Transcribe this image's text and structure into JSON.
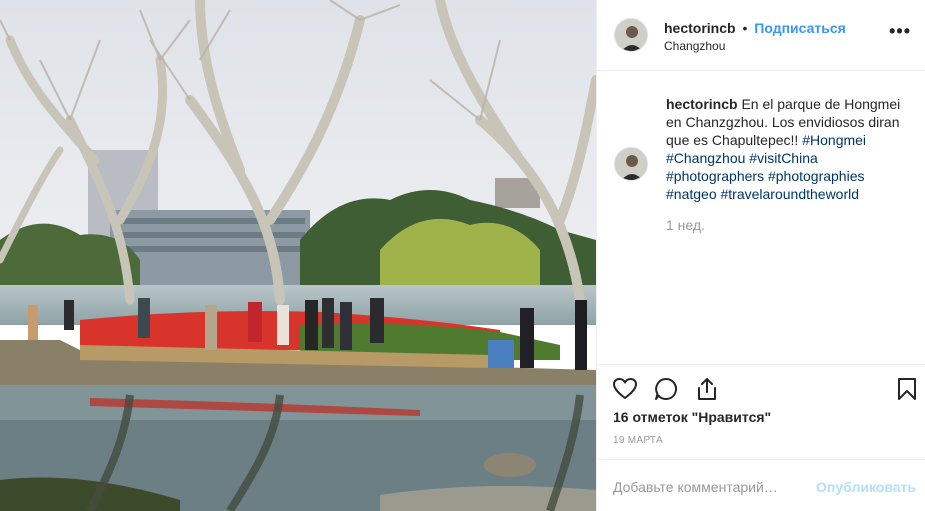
{
  "post": {
    "photo_alt": "Park scene with lake and trees",
    "header": {
      "username": "hectorincb",
      "separator": "•",
      "follow_label": "Подписаться",
      "location": "Changzhou",
      "more_icon": "more-dots-icon",
      "more_label": "•••"
    },
    "caption": {
      "username": "hectorincb",
      "text": "En el parque de Hongmei en Chanzgzhou. Los envidiosos diran que es Chapultepec!!",
      "hashtags": [
        "#Hongmei",
        "#Changzhou",
        "#visitChina",
        "#photographers",
        "#photographies",
        "#natgeo",
        "#travelaroundtheworld"
      ],
      "time_ago": "1 нед."
    },
    "actions": {
      "like_icon": "heart-icon",
      "comment_icon": "comment-icon",
      "share_icon": "share-icon",
      "save_icon": "bookmark-icon"
    },
    "likes_text": "16 отметок \"Нравится\"",
    "date_text": "19 МАРТА",
    "comment_box": {
      "placeholder": "Добавьте комментарий…",
      "publish_label": "Опубликовать"
    }
  }
}
